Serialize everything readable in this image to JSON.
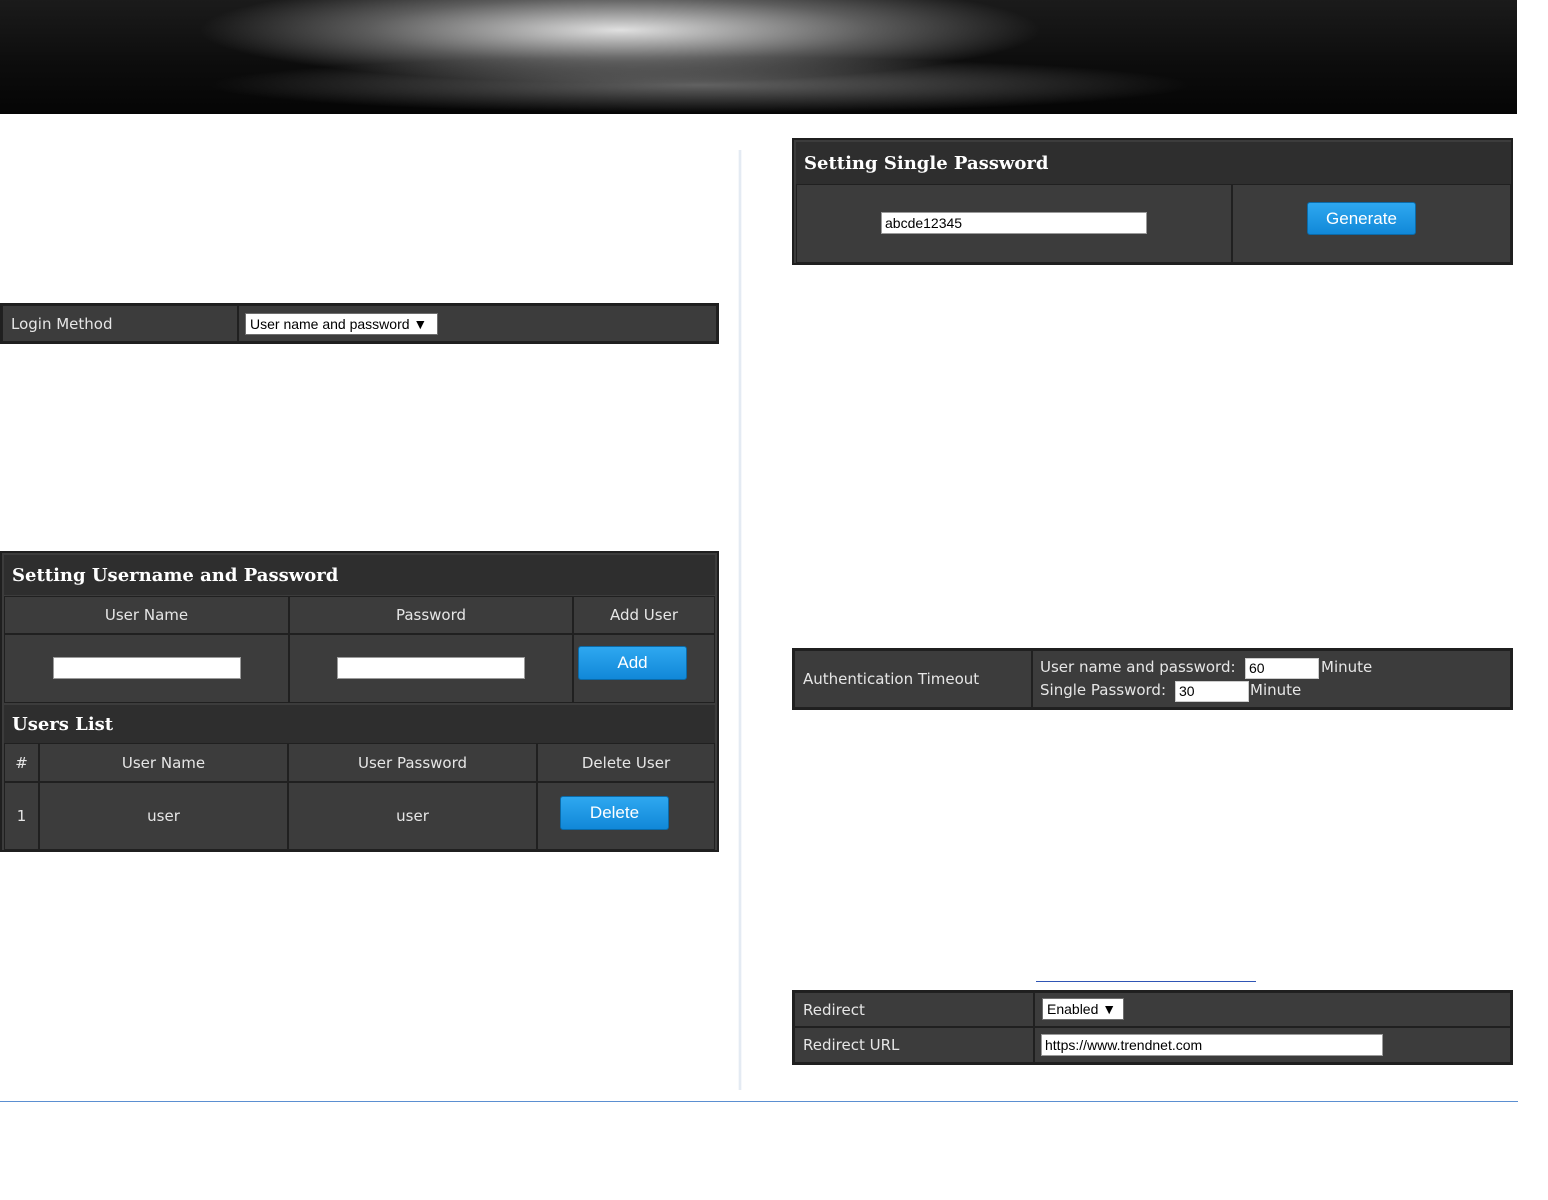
{
  "login": {
    "label": "Login Method",
    "method_value": "User name and password ▼"
  },
  "users_panel": {
    "title": "Setting Username and Password",
    "col_user_name": "User Name",
    "col_password": "Password",
    "col_add_user": "Add User",
    "user_name_value": "",
    "password_value": "",
    "add_label": "Add"
  },
  "users_list": {
    "title": "Users List",
    "col_index": "#",
    "col_user_name": "User Name",
    "col_user_password": "User Password",
    "col_delete": "Delete User",
    "rows": [
      {
        "index": "1",
        "user_name": "user",
        "user_password": "user",
        "delete_label": "Delete"
      }
    ]
  },
  "single_password": {
    "title": "Setting Single Password",
    "value": "abcde12345",
    "generate_label": "Generate"
  },
  "timeout": {
    "label": "Authentication Timeout",
    "user_pw_label": "User name and password:",
    "user_pw_value": "60",
    "single_label": "Single Password:",
    "single_value": "30",
    "unit": "Minute"
  },
  "redirect": {
    "label": "Redirect",
    "value": "Enabled ▼",
    "url_label": "Redirect URL",
    "url_value": "https://www.trendnet.com"
  }
}
